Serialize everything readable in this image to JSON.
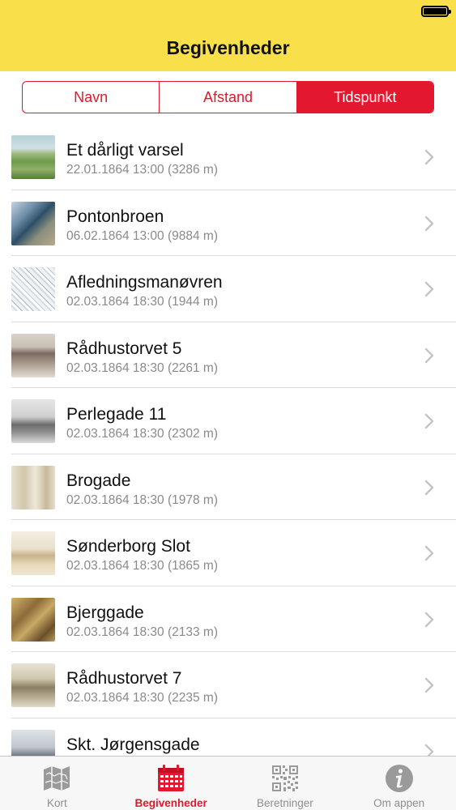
{
  "header": {
    "title": "Begivenheder"
  },
  "segments": [
    {
      "label": "Navn"
    },
    {
      "label": "Afstand"
    },
    {
      "label": "Tidspunkt",
      "selected": true
    }
  ],
  "events": [
    {
      "title": "Et dårligt varsel",
      "subtitle": "22.01.1864 13:00 (3286 m)"
    },
    {
      "title": "Pontonbroen",
      "subtitle": "06.02.1864 13:00 (9884 m)"
    },
    {
      "title": "Afledningsmanøvren",
      "subtitle": "02.03.1864 18:30 (1944 m)"
    },
    {
      "title": "Rådhustorvet 5",
      "subtitle": "02.03.1864 18:30 (2261 m)"
    },
    {
      "title": "Perlegade 11",
      "subtitle": "02.03.1864 18:30 (2302 m)"
    },
    {
      "title": "Brogade",
      "subtitle": "02.03.1864 18:30 (1978 m)"
    },
    {
      "title": "Sønderborg Slot",
      "subtitle": "02.03.1864 18:30 (1865 m)"
    },
    {
      "title": "Bjerggade",
      "subtitle": "02.03.1864 18:30 (2133 m)"
    },
    {
      "title": "Rådhustorvet 7",
      "subtitle": "02.03.1864 18:30 (2235 m)"
    },
    {
      "title": "Skt. Jørgensgade",
      "subtitle": ""
    }
  ],
  "tabs": [
    {
      "label": "Kort",
      "icon": "map-icon"
    },
    {
      "label": "Begivenheder",
      "icon": "calendar-icon",
      "active": true
    },
    {
      "label": "Beretninger",
      "icon": "qr-code-icon"
    },
    {
      "label": "Om appen",
      "icon": "info-icon"
    }
  ],
  "colors": {
    "accent": "#e3172d",
    "header_bg": "#f9df4a",
    "subtitle": "#8a8a8a",
    "tab_inactive": "#8e8e8e"
  }
}
